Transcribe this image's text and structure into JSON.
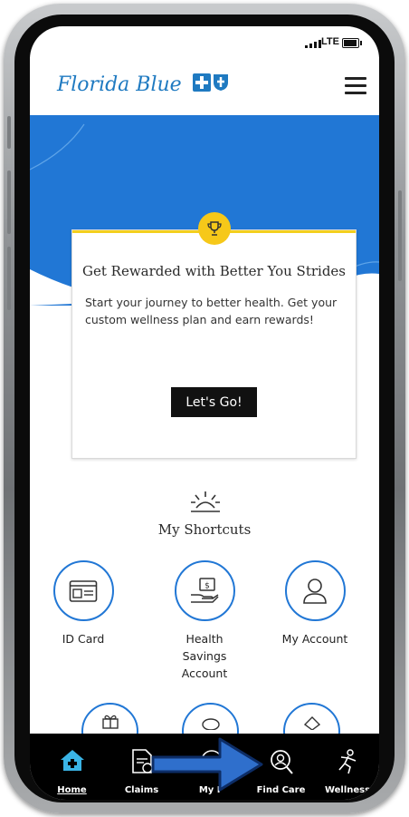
{
  "status": {
    "network": "LTE"
  },
  "header": {
    "logo_text": "Florida Blue",
    "menu_icon": "hamburger-menu-icon"
  },
  "promo_card": {
    "icon": "trophy-icon",
    "title": "Get Rewarded with Better You Strides",
    "body": "Start your journey to better health. Get your custom wellness plan and earn rewards!",
    "cta_label": "Let's Go!"
  },
  "shortcuts": {
    "title": "My Shortcuts",
    "items": [
      {
        "label": "ID Card",
        "icon": "id-card-icon"
      },
      {
        "label": "Health Savings Account",
        "icon": "health-savings-icon"
      },
      {
        "label": "My Account",
        "icon": "account-icon"
      }
    ]
  },
  "tabbar": {
    "items": [
      {
        "label": "Home",
        "icon": "home-icon",
        "active": true
      },
      {
        "label": "Claims",
        "icon": "claims-icon"
      },
      {
        "label": "My P",
        "icon": "plan-icon"
      },
      {
        "label": "Find Care",
        "icon": "find-care-icon"
      },
      {
        "label": "Wellness",
        "icon": "wellness-icon"
      }
    ]
  },
  "colors": {
    "brand_blue": "#2177d5",
    "accent_yellow": "#f6c819",
    "tab_active": "#3ab4e6"
  }
}
